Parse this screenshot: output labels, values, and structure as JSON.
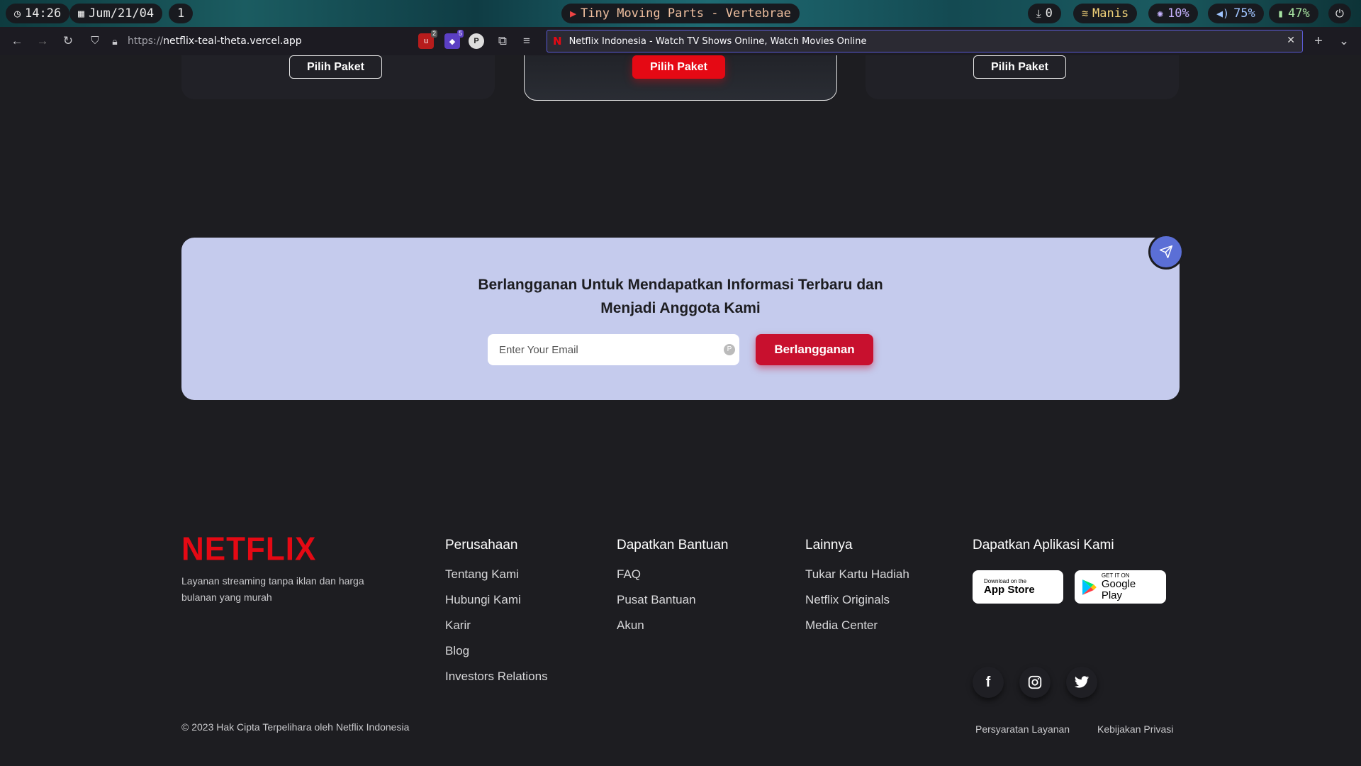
{
  "sysbar": {
    "time": "14:26",
    "date": "Jum/21/04",
    "workspace": "1",
    "now_playing": "Tiny Moving Parts - Vertebrae",
    "downloads": "0",
    "wifi": "Manis",
    "brightness": "10%",
    "volume": "75%",
    "battery": "47%"
  },
  "browser": {
    "url_prefix": "https://",
    "url_host": "netflix-teal-theta.vercel.app",
    "ext_badge_1": "2",
    "ext_badge_2": "5",
    "tab_title": "Netflix Indonesia - Watch TV Shows Online, Watch Movies Online"
  },
  "plans": {
    "button_label": "Pilih Paket"
  },
  "subscribe": {
    "title_line1": "Berlangganan Untuk Mendapatkan Informasi Terbaru dan",
    "title_line2": "Menjadi Anggota Kami",
    "email_placeholder": "Enter Your Email",
    "button_label": "Berlangganan"
  },
  "footer": {
    "logo": "NETFLIX",
    "tagline": "Layanan streaming tanpa iklan dan harga bulanan yang murah",
    "columns": [
      {
        "heading": "Perusahaan",
        "links": [
          "Tentang Kami",
          "Hubungi Kami",
          "Karir",
          "Blog",
          "Investors Relations"
        ]
      },
      {
        "heading": "Dapatkan Bantuan",
        "links": [
          "FAQ",
          "Pusat Bantuan",
          "Akun"
        ]
      },
      {
        "heading": "Lainnya",
        "links": [
          "Tukar Kartu Hadiah",
          "Netflix Originals",
          "Media Center"
        ]
      }
    ],
    "apps": {
      "heading": "Dapatkan Aplikasi Kami",
      "appstore_small": "Download on the",
      "appstore_big": "App Store",
      "googleplay_small": "GET IT ON",
      "googleplay_big": "Google Play"
    },
    "social_icons": [
      "facebook-icon",
      "instagram-icon",
      "twitter-icon"
    ],
    "copyright": "© 2023 Hak Cipta Terpelihara oleh Netflix Indonesia",
    "legal_terms": "Persyaratan Layanan",
    "legal_privacy": "Kebijakan Privasi"
  },
  "colors": {
    "brand_red": "#e50914",
    "background": "#1d1d21",
    "subscribe_bg": "#c5cbed",
    "fab": "#5b6fd6"
  }
}
